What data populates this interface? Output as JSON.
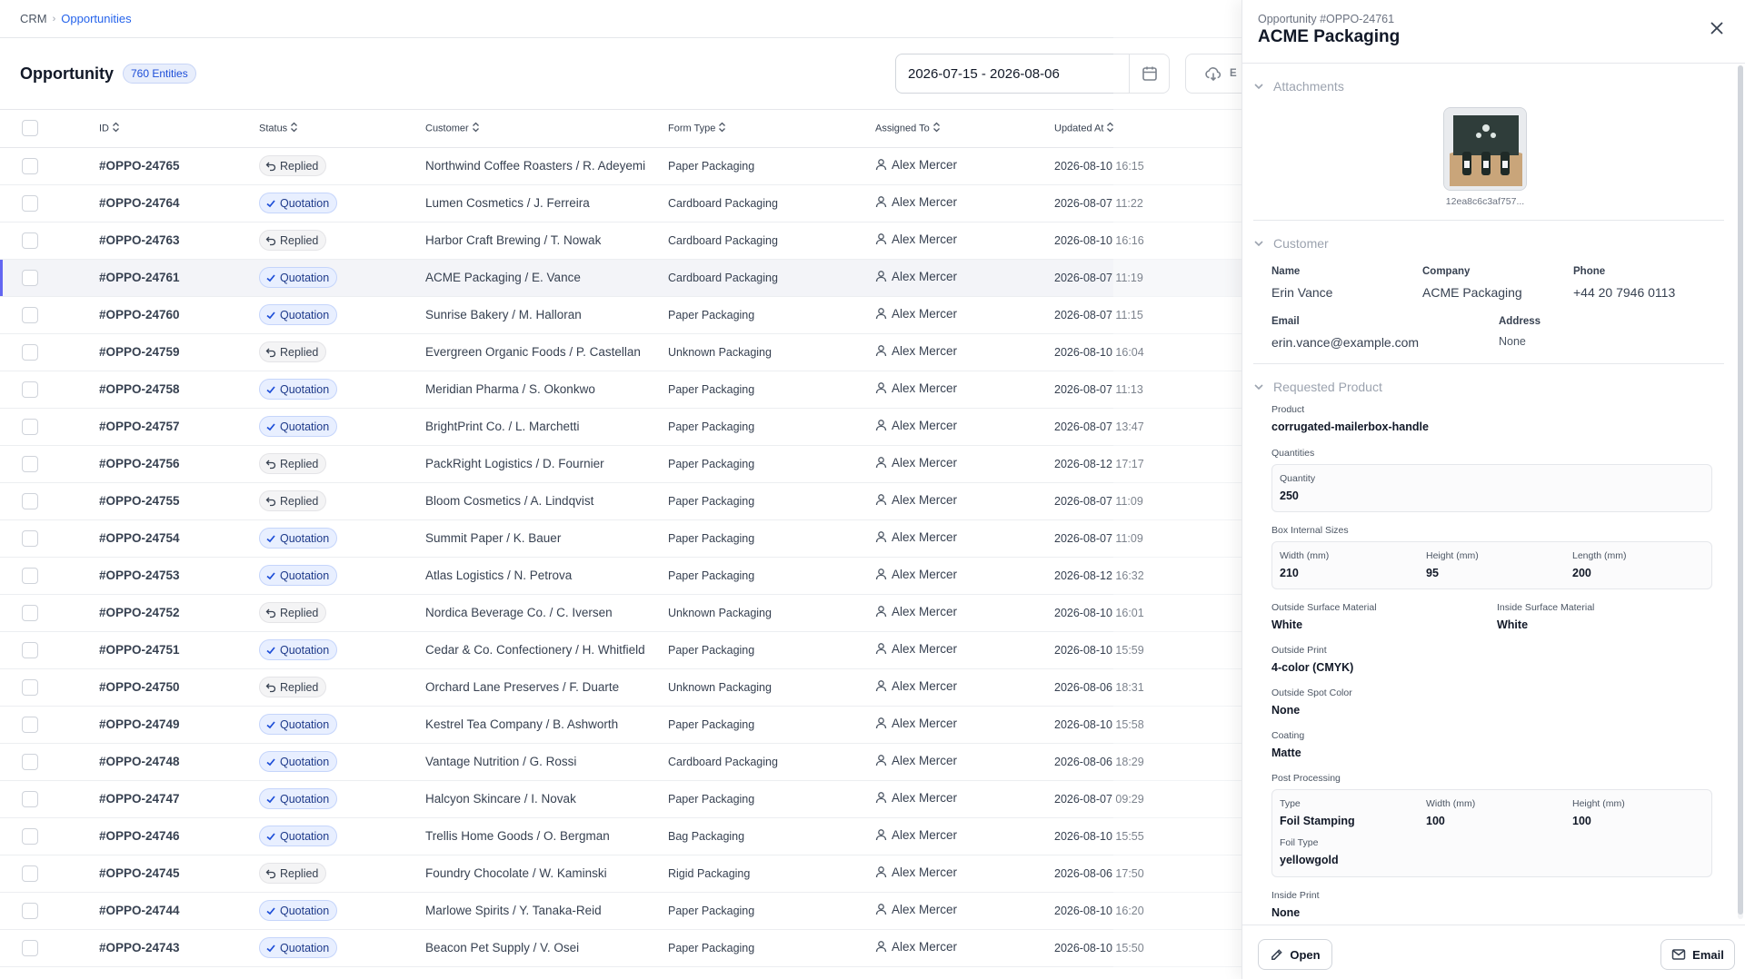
{
  "breadcrumb": {
    "root": "CRM",
    "separator": "›",
    "current": "Opportunities"
  },
  "page": {
    "title": "Opportunity",
    "count_badge": "760 Entities"
  },
  "date_range": {
    "value": "2026-07-15 - 2026-08-06",
    "icon": "calendar-icon"
  },
  "export": {
    "label": "E",
    "icon": "cloud-download-icon"
  },
  "columns": [
    "ID",
    "Status",
    "Customer",
    "Form Type",
    "Assigned To",
    "Updated At"
  ],
  "rows": [
    {
      "id": "#OPPO-24765",
      "status": "Replied",
      "customer": "Northwind Coffee Roasters / R. Adeyemi",
      "form": "Paper Packaging",
      "assignee": "Alex Mercer",
      "updated": "2026-08-10 16:15"
    },
    {
      "id": "#OPPO-24764",
      "status": "Quotation",
      "customer": "Lumen Cosmetics / J. Ferreira",
      "form": "Cardboard Packaging",
      "assignee": "Alex Mercer",
      "updated": "2026-08-07 11:22"
    },
    {
      "id": "#OPPO-24763",
      "status": "Replied",
      "customer": "Harbor Craft Brewing / T. Nowak",
      "form": "Cardboard Packaging",
      "assignee": "Alex Mercer",
      "updated": "2026-08-10 16:16"
    },
    {
      "id": "#OPPO-24761",
      "status": "Quotation",
      "customer": "ACME Packaging / E. Vance",
      "form": "Cardboard Packaging",
      "assignee": "Alex Mercer",
      "updated": "2026-08-07 11:19",
      "selected": true
    },
    {
      "id": "#OPPO-24760",
      "status": "Quotation",
      "customer": "Sunrise Bakery / M. Halloran",
      "form": "Paper Packaging",
      "assignee": "Alex Mercer",
      "updated": "2026-08-07 11:15"
    },
    {
      "id": "#OPPO-24759",
      "status": "Replied",
      "customer": "Evergreen Organic Foods / P. Castellan",
      "form": "Unknown Packaging",
      "assignee": "Alex Mercer",
      "updated": "2026-08-10 16:04"
    },
    {
      "id": "#OPPO-24758",
      "status": "Quotation",
      "customer": "Meridian Pharma / S. Okonkwo",
      "form": "Paper Packaging",
      "assignee": "Alex Mercer",
      "updated": "2026-08-07 11:13"
    },
    {
      "id": "#OPPO-24757",
      "status": "Quotation",
      "customer": "BrightPrint Co. / L. Marchetti",
      "form": "Paper Packaging",
      "assignee": "Alex Mercer",
      "updated": "2026-08-07 13:47"
    },
    {
      "id": "#OPPO-24756",
      "status": "Replied",
      "customer": "PackRight Logistics / D. Fournier",
      "form": "Paper Packaging",
      "assignee": "Alex Mercer",
      "updated": "2026-08-12 17:17"
    },
    {
      "id": "#OPPO-24755",
      "status": "Replied",
      "customer": "Bloom Cosmetics / A. Lindqvist",
      "form": "Paper Packaging",
      "assignee": "Alex Mercer",
      "updated": "2026-08-07 11:09"
    },
    {
      "id": "#OPPO-24754",
      "status": "Quotation",
      "customer": "Summit Paper / K. Bauer",
      "form": "Paper Packaging",
      "assignee": "Alex Mercer",
      "updated": "2026-08-07 11:09"
    },
    {
      "id": "#OPPO-24753",
      "status": "Quotation",
      "customer": "Atlas Logistics / N. Petrova",
      "form": "Paper Packaging",
      "assignee": "Alex Mercer",
      "updated": "2026-08-12 16:32"
    },
    {
      "id": "#OPPO-24752",
      "status": "Replied",
      "customer": "Nordica Beverage Co. / C. Iversen",
      "form": "Unknown Packaging",
      "assignee": "Alex Mercer",
      "updated": "2026-08-10 16:01"
    },
    {
      "id": "#OPPO-24751",
      "status": "Quotation",
      "customer": "Cedar & Co. Confectionery / H. Whitfield",
      "form": "Paper Packaging",
      "assignee": "Alex Mercer",
      "updated": "2026-08-10 15:59"
    },
    {
      "id": "#OPPO-24750",
      "status": "Replied",
      "customer": "Orchard Lane Preserves / F. Duarte",
      "form": "Unknown Packaging",
      "assignee": "Alex Mercer",
      "updated": "2026-08-06 18:31"
    },
    {
      "id": "#OPPO-24749",
      "status": "Quotation",
      "customer": "Kestrel Tea Company / B. Ashworth",
      "form": "Paper Packaging",
      "assignee": "Alex Mercer",
      "updated": "2026-08-10 15:58"
    },
    {
      "id": "#OPPO-24748",
      "status": "Quotation",
      "customer": "Vantage Nutrition / G. Rossi",
      "form": "Cardboard Packaging",
      "assignee": "Alex Mercer",
      "updated": "2026-08-06 18:29"
    },
    {
      "id": "#OPPO-24747",
      "status": "Quotation",
      "customer": "Halcyon Skincare / I. Novak",
      "form": "Paper Packaging",
      "assignee": "Alex Mercer",
      "updated": "2026-08-07 09:29"
    },
    {
      "id": "#OPPO-24746",
      "status": "Quotation",
      "customer": "Trellis Home Goods / O. Bergman",
      "form": "Bag Packaging",
      "assignee": "Alex Mercer",
      "updated": "2026-08-10 15:55"
    },
    {
      "id": "#OPPO-24745",
      "status": "Replied",
      "customer": "Foundry Chocolate / W. Kaminski",
      "form": "Rigid Packaging",
      "assignee": "Alex Mercer",
      "updated": "2026-08-06 17:50"
    },
    {
      "id": "#OPPO-24744",
      "status": "Quotation",
      "customer": "Marlowe Spirits / Y. Tanaka-Reid",
      "form": "Paper Packaging",
      "assignee": "Alex Mercer",
      "updated": "2026-08-10 16:20"
    },
    {
      "id": "#OPPO-24743",
      "status": "Quotation",
      "customer": "Beacon Pet Supply / V. Osei",
      "form": "Paper Packaging",
      "assignee": "Alex Mercer",
      "updated": "2026-08-10 15:50"
    }
  ],
  "panel": {
    "subtitle": "Opportunity #OPPO-24761",
    "title": "ACME Packaging",
    "attachments": {
      "heading": "Attachments",
      "file_name": "12ea8c6c3af757..."
    },
    "customer": {
      "heading": "Customer",
      "name_label": "Name",
      "name": "Erin Vance",
      "company_label": "Company",
      "company": "ACME Packaging",
      "phone_label": "Phone",
      "phone": "+44 20 7946 0113",
      "email_label": "Email",
      "email": "erin.vance@example.com",
      "address_label": "Address",
      "address": "None"
    },
    "product": {
      "heading": "Requested Product",
      "product_label": "Product",
      "product": "corrugated-mailerbox-handle",
      "quantities_label": "Quantities",
      "quantity_label": "Quantity",
      "quantity": "250",
      "sizes_label": "Box Internal Sizes",
      "width_label": "Width (mm)",
      "width": "210",
      "height_label": "Height (mm)",
      "height": "95",
      "length_label": "Length (mm)",
      "length": "200",
      "outside_material_label": "Outside Surface Material",
      "outside_material": "White",
      "inside_material_label": "Inside Surface Material",
      "inside_material": "White",
      "outside_print_label": "Outside Print",
      "outside_print": "4-color (CMYK)",
      "spot_color_label": "Outside Spot Color",
      "spot_color": "None",
      "coating_label": "Coating",
      "coating": "Matte",
      "post_processing_label": "Post Processing",
      "pp_type_label": "Type",
      "pp_type": "Foil Stamping",
      "pp_width_label": "Width (mm)",
      "pp_width": "100",
      "pp_height_label": "Height (mm)",
      "pp_height": "100",
      "foil_type_label": "Foil Type",
      "foil_type": "yellowgold",
      "inside_print_label": "Inside Print",
      "inside_print": "None"
    },
    "footer": {
      "open_label": "Open",
      "email_label": "Email"
    }
  }
}
